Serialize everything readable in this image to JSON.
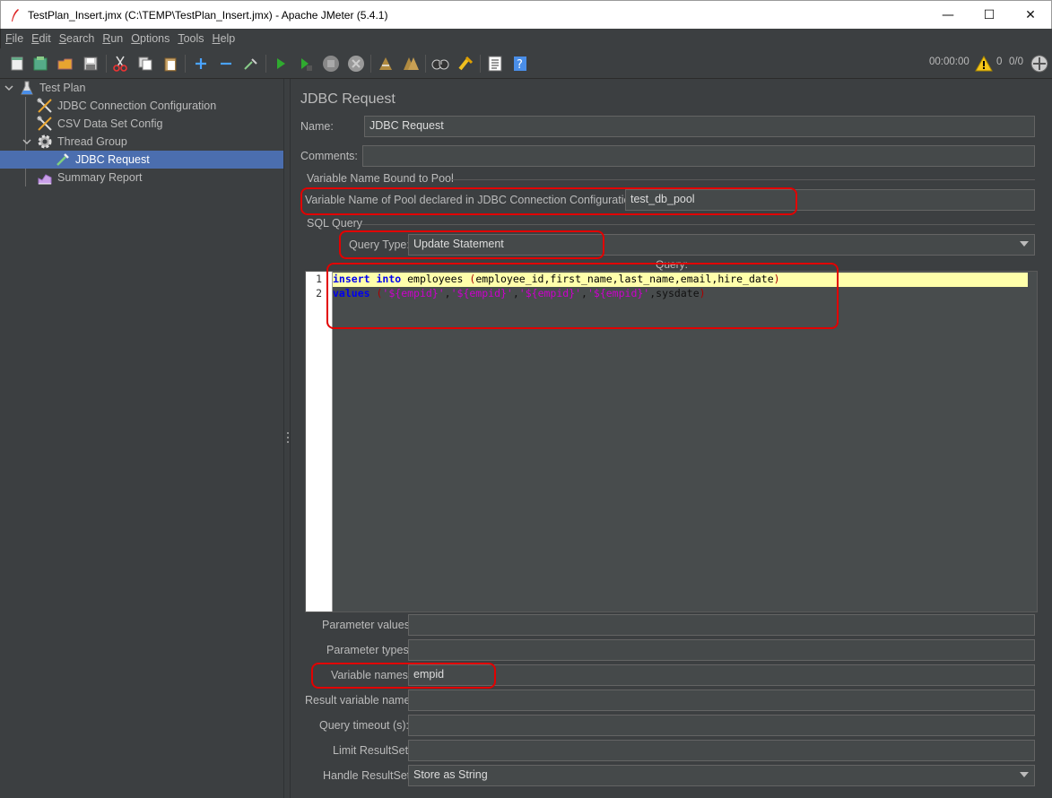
{
  "window": {
    "title": "TestPlan_Insert.jmx (C:\\TEMP\\TestPlan_Insert.jmx) - Apache JMeter (5.4.1)",
    "minimize": "—",
    "maximize": "☐",
    "close": "✕"
  },
  "menu": [
    {
      "mn": "F",
      "rest": "ile"
    },
    {
      "mn": "E",
      "rest": "dit"
    },
    {
      "mn": "S",
      "rest": "earch"
    },
    {
      "mn": "R",
      "rest": "un"
    },
    {
      "mn": "O",
      "rest": "ptions"
    },
    {
      "mn": "T",
      "rest": "ools"
    },
    {
      "mn": "H",
      "rest": "elp"
    }
  ],
  "toolbar": {
    "elapsed_time": "00:00:00",
    "error_count": "0",
    "threads": "0/0"
  },
  "tree": {
    "items": [
      {
        "label": "Test Plan",
        "icon": "flask-icon"
      },
      {
        "label": "JDBC Connection Configuration",
        "icon": "wrench-icon"
      },
      {
        "label": "CSV Data Set Config",
        "icon": "wrench-icon"
      },
      {
        "label": "Thread Group",
        "icon": "gear-icon"
      },
      {
        "label": "JDBC Request",
        "icon": "pipette-icon"
      },
      {
        "label": "Summary Report",
        "icon": "chart-icon"
      }
    ],
    "selected": "JDBC Request"
  },
  "panel": {
    "heading": "JDBC Request",
    "name_label": "Name:",
    "name_value": "JDBC Request",
    "comments_label": "Comments:",
    "comments_value": "",
    "pool_group_title": "Variable Name Bound to Pool",
    "pool_label": "Variable Name of Pool declared in JDBC Connection Configuration:",
    "pool_value": "test_db_pool",
    "sql_group_title": "SQL Query",
    "query_type_label": "Query Type:",
    "query_type_value": "Update Statement",
    "query_label": "Query:",
    "code": {
      "line_numbers": [
        "1",
        "2"
      ],
      "line1": {
        "kw1": "insert",
        "kw2": "into",
        "table": "employees",
        "open": "(",
        "cols": "employee_id,first_name,last_name,email,hire_date",
        "close": ")"
      },
      "line2": {
        "kw": "values",
        "open": "(",
        "v1": "'${empid}'",
        "c1": ",",
        "v2": "'${empid}'",
        "c2": ",",
        "v3": "'${empid}'",
        "c3": ",",
        "v4": "'${empid}'",
        "tail": ",sysdate",
        "close": ")"
      }
    },
    "param_values_label": "Parameter values:",
    "param_values_value": "",
    "param_types_label": "Parameter types:",
    "param_types_value": "",
    "variable_names_label": "Variable names:",
    "variable_names_value": "empid",
    "result_var_label": "Result variable name:",
    "result_var_value": "",
    "query_timeout_label": "Query timeout (s):",
    "query_timeout_value": "",
    "limit_resultset_label": "Limit ResultSet:",
    "limit_resultset_value": "",
    "handle_resultset_label": "Handle ResultSet:",
    "handle_resultset_value": "Store as String"
  },
  "colors": {
    "background": "#3c3f41",
    "selection": "#4b6eaf",
    "annotation": "#e20000",
    "keyword": "#0000ee",
    "string": "#cc00cc"
  }
}
